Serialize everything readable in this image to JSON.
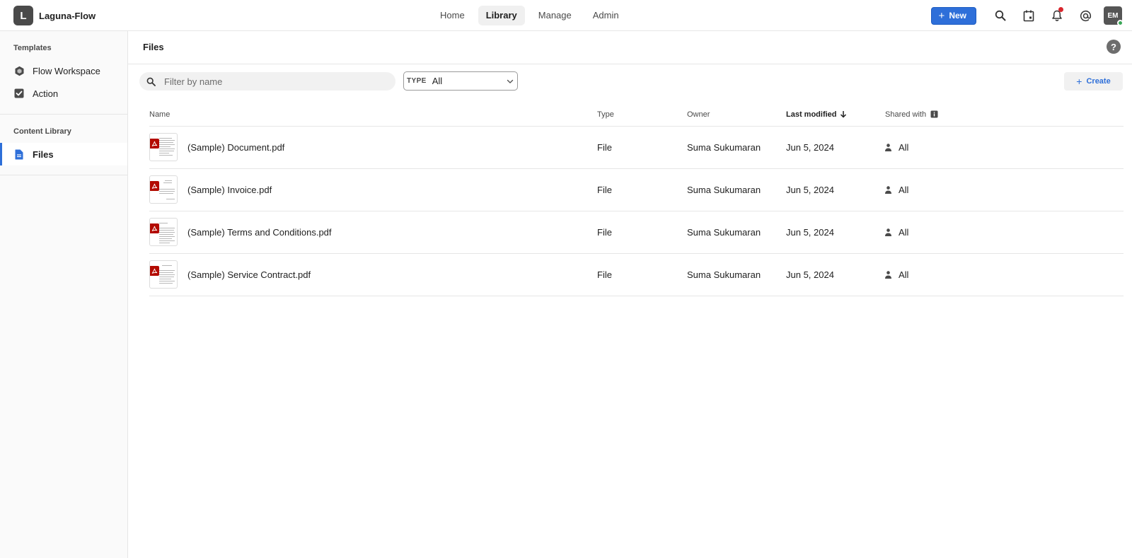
{
  "app": {
    "logo_letter": "L",
    "name": "Laguna-Flow"
  },
  "nav": {
    "tabs": [
      {
        "label": "Home",
        "active": false
      },
      {
        "label": "Library",
        "active": true
      },
      {
        "label": "Manage",
        "active": false
      },
      {
        "label": "Admin",
        "active": false
      }
    ]
  },
  "header": {
    "new_label": "New",
    "avatar_initials": "EM",
    "icons": [
      "search-icon",
      "calendar-icon",
      "bell-icon",
      "mention-icon"
    ],
    "notification_dot_color": "#d9262d"
  },
  "sidebar": {
    "sections": [
      {
        "heading": "Templates",
        "items": [
          {
            "label": "Flow Workspace",
            "icon": "hexagon-icon",
            "active": false
          },
          {
            "label": "Action",
            "icon": "checkbox-icon",
            "active": false
          }
        ]
      },
      {
        "heading": "Content Library",
        "items": [
          {
            "label": "Files",
            "icon": "file-icon",
            "active": true
          }
        ]
      }
    ]
  },
  "page": {
    "title": "Files",
    "help_glyph": "?"
  },
  "toolbar": {
    "search_placeholder": "Filter by name",
    "type_label": "TYPE",
    "type_value": "All",
    "create_label": "Create"
  },
  "table": {
    "columns": {
      "name": "Name",
      "type": "Type",
      "owner": "Owner",
      "modified": "Last modified",
      "shared": "Shared with"
    },
    "sort": {
      "column": "Last modified",
      "direction": "desc"
    },
    "rows": [
      {
        "name": "(Sample) Document.pdf",
        "type": "File",
        "owner": "Suma Sukumaran",
        "modified": "Jun 5, 2024",
        "shared": "All"
      },
      {
        "name": "(Sample) Invoice.pdf",
        "type": "File",
        "owner": "Suma Sukumaran",
        "modified": "Jun 5, 2024",
        "shared": "All"
      },
      {
        "name": "(Sample) Terms and Conditions.pdf",
        "type": "File",
        "owner": "Suma Sukumaran",
        "modified": "Jun 5, 2024",
        "shared": "All"
      },
      {
        "name": "(Sample) Service Contract.pdf",
        "type": "File",
        "owner": "Suma Sukumaran",
        "modified": "Jun 5, 2024",
        "shared": "All"
      }
    ]
  },
  "colors": {
    "accent": "#2e6fd9",
    "pdf_badge": "#b30b00",
    "presence": "#3aa757"
  }
}
